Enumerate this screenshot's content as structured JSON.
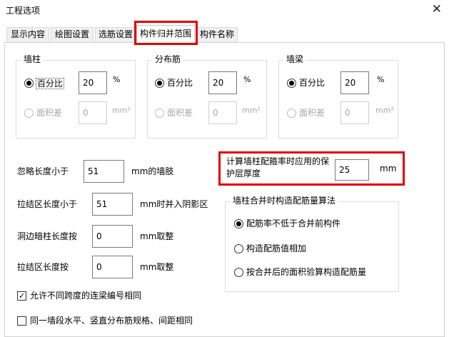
{
  "window": {
    "title": "工程选项",
    "close_glyph": "✕"
  },
  "tabs": [
    {
      "label": "显示内容"
    },
    {
      "label": "绘图设置"
    },
    {
      "label": "选筋设置"
    },
    {
      "label": "构件归并范围"
    },
    {
      "label": "构件名称"
    }
  ],
  "groups": [
    {
      "title": "墙柱",
      "opt1": "百分比",
      "opt2": "面积差",
      "value1": "20",
      "unit1": "%",
      "value2": "0",
      "unit2": "mm²"
    },
    {
      "title": "分布筋",
      "opt1": "百分比",
      "opt2": "面积差",
      "value1": "20",
      "unit1": "%",
      "value2": "0",
      "unit2": "mm²"
    },
    {
      "title": "墙梁",
      "opt1": "百分比",
      "opt2": "面积差",
      "value1": "20",
      "unit1": "%",
      "value2": "0",
      "unit2": "mm²"
    }
  ],
  "settings": {
    "ignore_length": {
      "label": "忽略长度小于",
      "value": "51",
      "suffix": "mm的墙肢"
    },
    "tie_zone_min": {
      "label": "拉结区长度小于",
      "value": "51",
      "suffix": "mm时并入阴影区"
    },
    "hole_column": {
      "label": "洞边暗柱长度按",
      "value": "0",
      "suffix": "mm取整"
    },
    "tie_zone_round": {
      "label": "拉结区长度按",
      "value": "0",
      "suffix": "mm取整"
    }
  },
  "protect_layer": {
    "label_line1": "计算墙柱配箍率时应用的保",
    "label_line2": "护层厚度",
    "value": "25",
    "unit": "mm"
  },
  "algo_group": {
    "title": "墙柱合并时构造配筋量算法",
    "options": [
      {
        "label": "配筋率不低于合并前构件",
        "selected": true
      },
      {
        "label": "构造配筋值相加",
        "selected": false
      },
      {
        "label": "按合并后的面积验算构造配筋量",
        "selected": false
      }
    ]
  },
  "checkboxes": [
    {
      "label": "允许不同跨度的连梁编号相同",
      "checked": true
    },
    {
      "label": "同一墙段水平、竖直分布筋规格、间距相同",
      "checked": false
    }
  ]
}
